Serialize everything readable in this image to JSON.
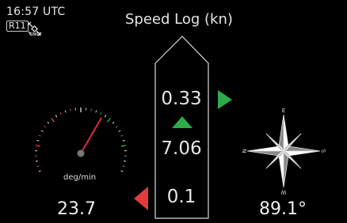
{
  "status": {
    "time": "16:57 UTC",
    "badge": "R11",
    "gnss_label": "GNSS"
  },
  "title": "Speed Log (kn)",
  "speed_log": {
    "upper_value": "0.33",
    "main_value": "7.06",
    "lower_value": "0.1"
  },
  "rate_of_turn": {
    "unit": "deg/min",
    "value": "23.7"
  },
  "heading": {
    "value": "89.1°",
    "compass_labels": [
      "E",
      "S",
      "W",
      "N"
    ]
  },
  "colors": {
    "green": "#2faa4a",
    "red": "#e23b3b",
    "needle": "#e0283a"
  }
}
